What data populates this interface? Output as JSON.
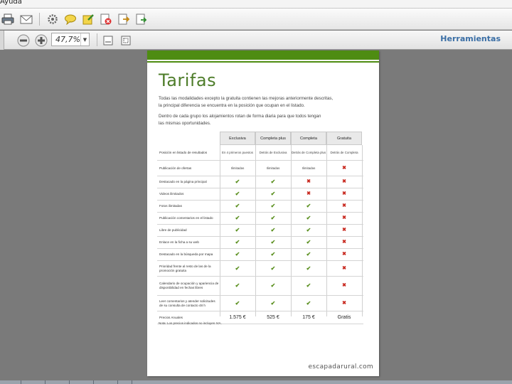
{
  "menu": {
    "item": "Ayuda"
  },
  "zoom": {
    "value": "47,7%"
  },
  "tools": {
    "label": "Herramientas"
  },
  "doc": {
    "title": "Tarifas",
    "para1_line1": "Todas las modalidades excepto la gratuita contienen las mejoras anteriormente descritas,",
    "para1_line2": "la principal diferencia se encuentra en la posición que ocupan en el listado.",
    "para2_line1": "Dentro de cada grupo los alojamientos rotan de forma diaria para que todos tengan",
    "para2_line2": "las mismas oportunidades.",
    "columns": [
      "Exclusiva",
      "Completa plus",
      "Completa",
      "Gratuita"
    ],
    "rows": [
      {
        "label": "Posición en listado de resultados",
        "cells": [
          "En 4 primeros puestos",
          "Detrás de Exclusiva",
          "Detrás de Completa plus",
          "Detrás de Completa"
        ],
        "h": 22
      },
      {
        "label": "Publicación de ofertas",
        "cells": [
          "Ilimitadas",
          "Ilimitadas",
          "Ilimitadas",
          "no"
        ],
        "h": 22
      },
      {
        "label": "Destacado en la página principal",
        "cells": [
          "si",
          "si",
          "no",
          "no"
        ],
        "h": 17
      },
      {
        "label": "Videos ilimitados",
        "cells": [
          "si",
          "si",
          "no",
          "no"
        ],
        "h": 17
      },
      {
        "label": "Fotos ilimitadas",
        "cells": [
          "si",
          "si",
          "si",
          "no"
        ],
        "h": 17
      },
      {
        "label": "Publicación comentarios en el listado",
        "cells": [
          "si",
          "si",
          "si",
          "no"
        ],
        "h": 17
      },
      {
        "label": "Libre de publicidad",
        "cells": [
          "si",
          "si",
          "si",
          "no"
        ],
        "h": 17
      },
      {
        "label": "Enlace en la ficha a su web",
        "cells": [
          "si",
          "si",
          "si",
          "no"
        ],
        "h": 17
      },
      {
        "label": "Destacado en la búsqueda por mapa",
        "cells": [
          "si",
          "si",
          "si",
          "no"
        ],
        "h": 17
      },
      {
        "label": "Prioridad frente al resto de las de la promoción gratuita",
        "cells": [
          "si",
          "si",
          "si",
          "no"
        ],
        "h": 22
      },
      {
        "label": "Calendario de ocupación y apariencia de disponibilidad en fechas libres",
        "cells": [
          "si",
          "si",
          "si",
          "no"
        ],
        "h": 27
      },
      {
        "label": "Leer comentarios y atender solicitudes de su consulta de contacto 48 h",
        "cells": [
          "si",
          "si",
          "si",
          "no"
        ],
        "h": 22
      },
      {
        "label": "Precios Anuales",
        "cells": [
          "1.575 €",
          "525 €",
          "175 €",
          "Gratis"
        ],
        "h": 18,
        "price": true
      }
    ],
    "note": "Nota: Los precios indicados no incluyen IVA.",
    "footer": "escapadarural.com"
  },
  "colors": {
    "green": "#4e8c12",
    "check": "#5a8f1e",
    "cross": "#c8281e",
    "title": "#4e7d2a"
  }
}
